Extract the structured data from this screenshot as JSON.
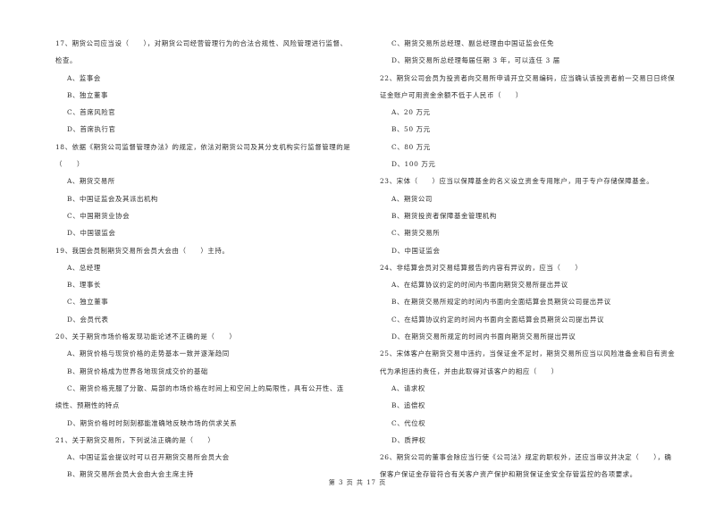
{
  "left_column": [
    {
      "type": "q",
      "text": "17、期货公司应当设（　　），对期货公司经营管理行为的合法合规性、风险管理进行监督、"
    },
    {
      "type": "q",
      "text": "检查。"
    },
    {
      "type": "opt",
      "text": "A、监事会"
    },
    {
      "type": "opt",
      "text": "B、独立董事"
    },
    {
      "type": "opt",
      "text": "C、首席风险官"
    },
    {
      "type": "opt",
      "text": "D、首席执行官"
    },
    {
      "type": "q",
      "text": "18、依据《期货公司监督管理办法》的规定，依法对期货公司及其分支机构实行监督管理的是"
    },
    {
      "type": "q",
      "text": "（　　）"
    },
    {
      "type": "opt",
      "text": "A、期货交易所"
    },
    {
      "type": "opt",
      "text": "B、中国证监会及其派出机构"
    },
    {
      "type": "opt",
      "text": "C、中国期货业协会"
    },
    {
      "type": "opt",
      "text": "D、中国银监会"
    },
    {
      "type": "q",
      "text": "19、我国会员制期货交易所会员大会由（　　）主持。"
    },
    {
      "type": "opt",
      "text": "A、总经理"
    },
    {
      "type": "opt",
      "text": "B、理事长"
    },
    {
      "type": "opt",
      "text": "C、独立董事"
    },
    {
      "type": "opt",
      "text": "D、会员代表"
    },
    {
      "type": "q",
      "text": "20、关于期货市场价格发现功能论述不正确的是（　　）"
    },
    {
      "type": "opt",
      "text": "A、期货价格与现货价格的走势基本一致并逐渐趋同"
    },
    {
      "type": "opt",
      "text": "B、期货价格成为世界各地现货成交价的基础"
    },
    {
      "type": "opt",
      "text": "C、期货价格克服了分散、局部的市场价格在时间上和空间上的局限性，具有公开性、连"
    },
    {
      "type": "q",
      "text": "续性、预期性的特点"
    },
    {
      "type": "opt",
      "text": "D、期货价格时时刻刻都能准确地反映市场的供求关系"
    },
    {
      "type": "q",
      "text": "21、关于期货交易所，下列说法正确的是（　　）"
    },
    {
      "type": "opt",
      "text": "A、中国证监会提议时可以召开期货交易所会员大会"
    },
    {
      "type": "opt",
      "text": "B、期货交易所会员大会由大会主席主持"
    }
  ],
  "right_column": [
    {
      "type": "opt",
      "text": "C、期货交易所总经理、副总经理由中国证监会任免"
    },
    {
      "type": "opt",
      "text": "D、期货交易所总经理每届任期 3 年，可以连任 3 届"
    },
    {
      "type": "q",
      "text": "22、期货公司会员为投资者向交易所申请开立交易编码，应当确认该投资者前一交易日日终保"
    },
    {
      "type": "q",
      "text": "证金账户可用资金余额不低于人民币（　　）"
    },
    {
      "type": "opt",
      "text": "A、20 万元"
    },
    {
      "type": "opt",
      "text": "B、50 万元"
    },
    {
      "type": "opt",
      "text": "C、80 万元"
    },
    {
      "type": "opt",
      "text": "D、100 万元"
    },
    {
      "type": "q",
      "text": "23、宋体（　　）应当以保障基金的名义设立资金专用账户，用于专户存储保障基金。"
    },
    {
      "type": "opt",
      "text": "A、期货公司"
    },
    {
      "type": "opt",
      "text": "B、期货投资者保障基金管理机构"
    },
    {
      "type": "opt",
      "text": "C、期货交易所"
    },
    {
      "type": "opt",
      "text": "D、中国证监会"
    },
    {
      "type": "q",
      "text": "24、非结算会员对交易结算报告的内容有异议的，应当（　　）"
    },
    {
      "type": "opt",
      "text": "A、在结算协议约定的时间内书面向期货交易所提出异议"
    },
    {
      "type": "opt",
      "text": "B、在期货交易所规定的时间内书面向全面结算会员期货公司提出异议"
    },
    {
      "type": "opt",
      "text": "C、在结算协议约定的时间内书面向全面结算会员期货公司提出异议"
    },
    {
      "type": "opt",
      "text": "D、在期货交易所规定的时间内书面向期货交易所提出异议"
    },
    {
      "type": "q",
      "text": "25、宋体客户在期货交易中违约，当保证金不足时，期货交易所应当以风险准备金和自有资金"
    },
    {
      "type": "q",
      "text": "代为承担违约责任，并由此取得对该客户的相应（　　）"
    },
    {
      "type": "opt",
      "text": "A、请求权"
    },
    {
      "type": "opt",
      "text": "B、追偿权"
    },
    {
      "type": "opt",
      "text": "C、代位权"
    },
    {
      "type": "opt",
      "text": "D、质押权"
    },
    {
      "type": "q",
      "text": "26、期货公司的董事会除应当行使《公司法》规定的职权外，还应当审议并决定（　　），确"
    },
    {
      "type": "q",
      "text": "保客户保证金存管符合有关客户资产保护和期货保证金安全存管监控的各项要求。"
    }
  ],
  "footer": {
    "page_label": "第 3 页 共 17 页"
  }
}
